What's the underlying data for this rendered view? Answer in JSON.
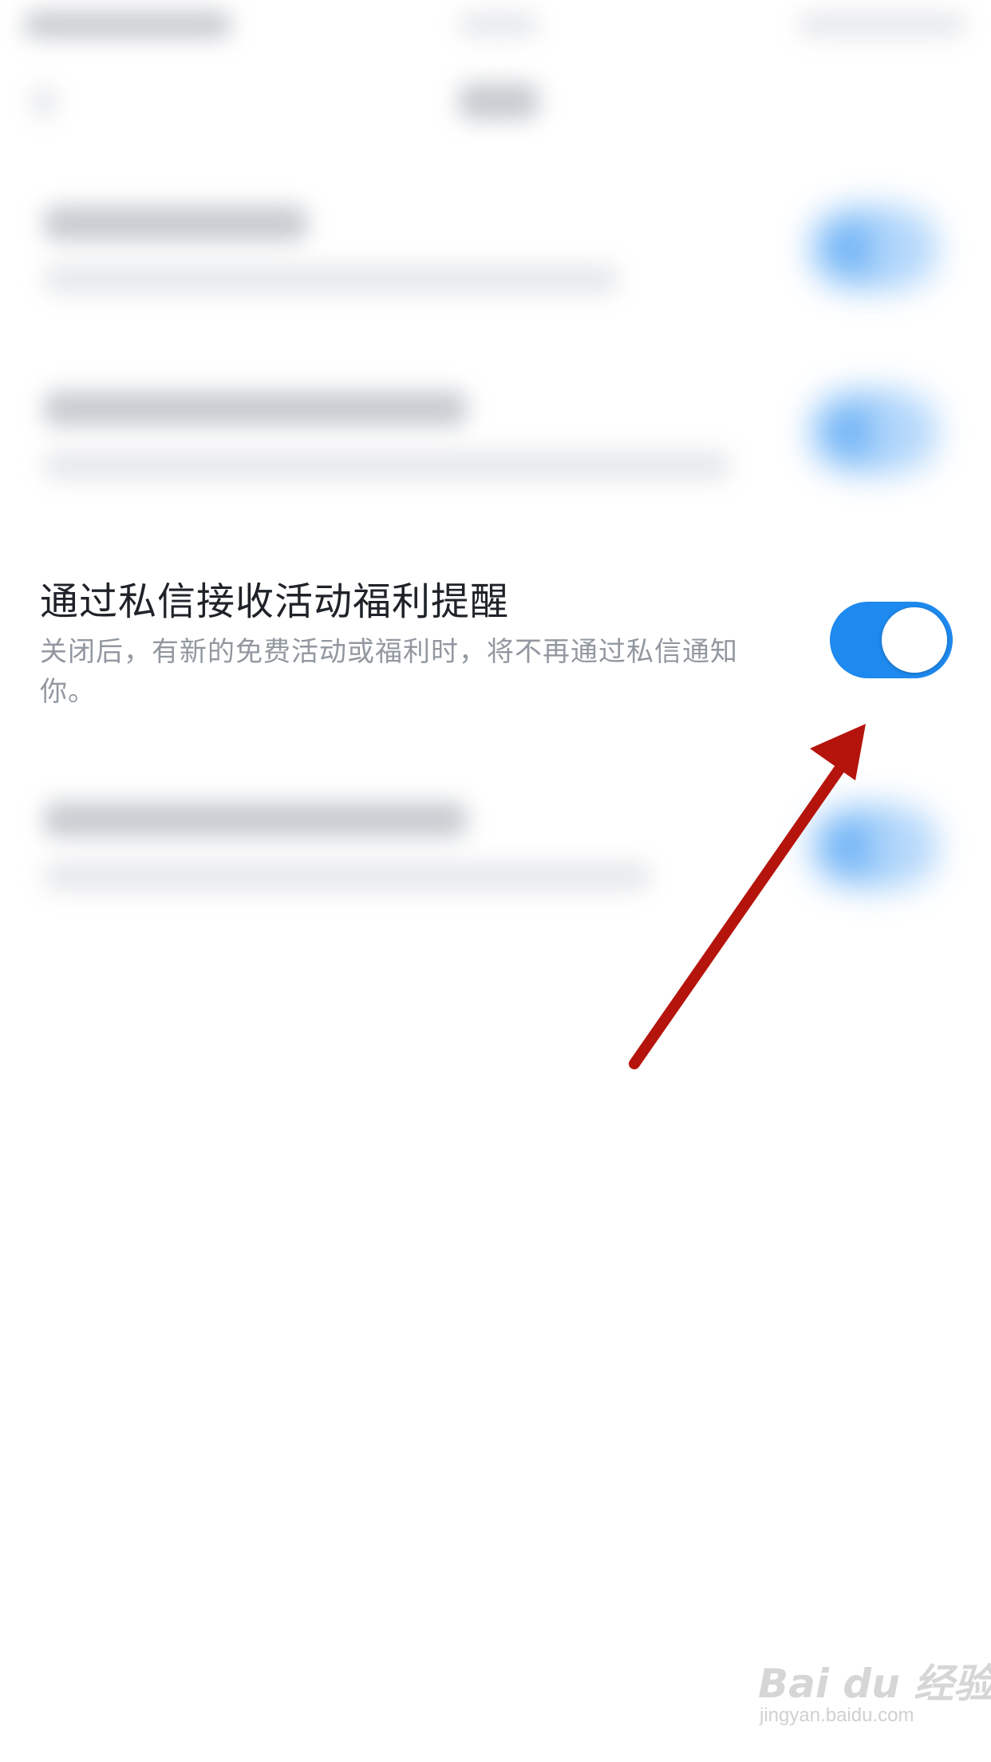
{
  "setting": {
    "title": "通过私信接收活动福利提醒",
    "description": "关闭后，有新的免费活动或福利时，将不再通过私信通知你。",
    "toggle_state": "on"
  },
  "watermark": {
    "logo": "Bai du 经验",
    "url": "jingyan.baidu.com"
  },
  "colors": {
    "toggle_on": "#1e89ee",
    "arrow": "#b5140c",
    "title_text": "#1f2329",
    "desc_text": "#9298a0"
  }
}
